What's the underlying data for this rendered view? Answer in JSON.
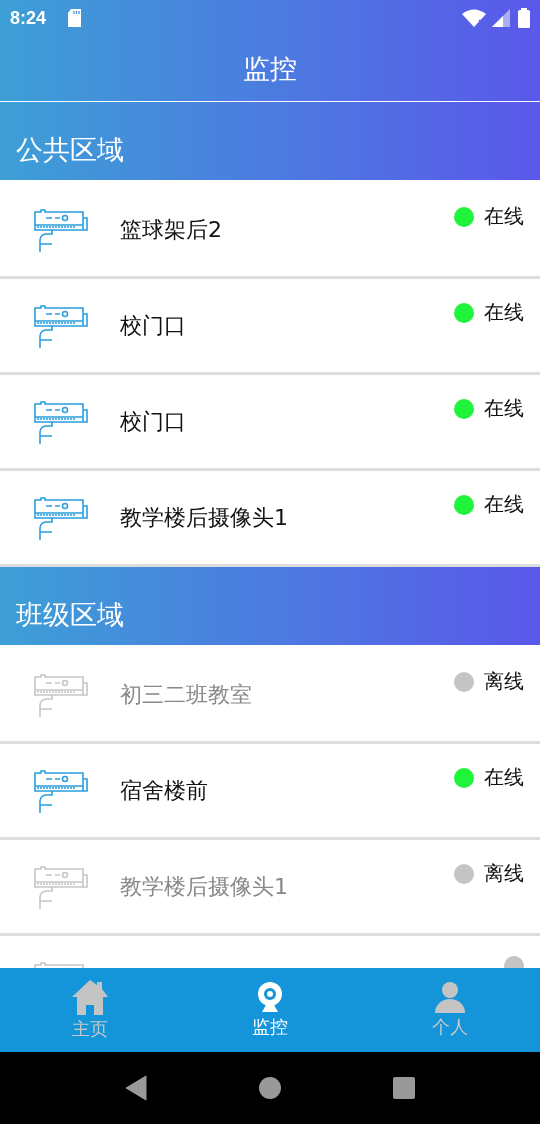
{
  "status_bar": {
    "time": "8:24"
  },
  "header": {
    "title": "监控"
  },
  "sections": [
    {
      "title": "公共区域",
      "cameras": [
        {
          "name": "篮球架后2",
          "status": "在线",
          "online": true
        },
        {
          "name": "校门口",
          "status": "在线",
          "online": true
        },
        {
          "name": "校门口",
          "status": "在线",
          "online": true
        },
        {
          "name": "教学楼后摄像头1",
          "status": "在线",
          "online": true
        }
      ]
    },
    {
      "title": "班级区域",
      "cameras": [
        {
          "name": "初三二班教室",
          "status": "离线",
          "online": false
        },
        {
          "name": "宿舍楼前",
          "status": "在线",
          "online": true
        },
        {
          "name": "教学楼后摄像头1",
          "status": "离线",
          "online": false
        },
        {
          "online": false
        }
      ]
    }
  ],
  "tab_bar": [
    {
      "label": "主页",
      "kind": "home",
      "selected": false
    },
    {
      "label": "监控",
      "kind": "camera",
      "selected": true
    },
    {
      "label": "个人",
      "kind": "person",
      "selected": false
    }
  ]
}
